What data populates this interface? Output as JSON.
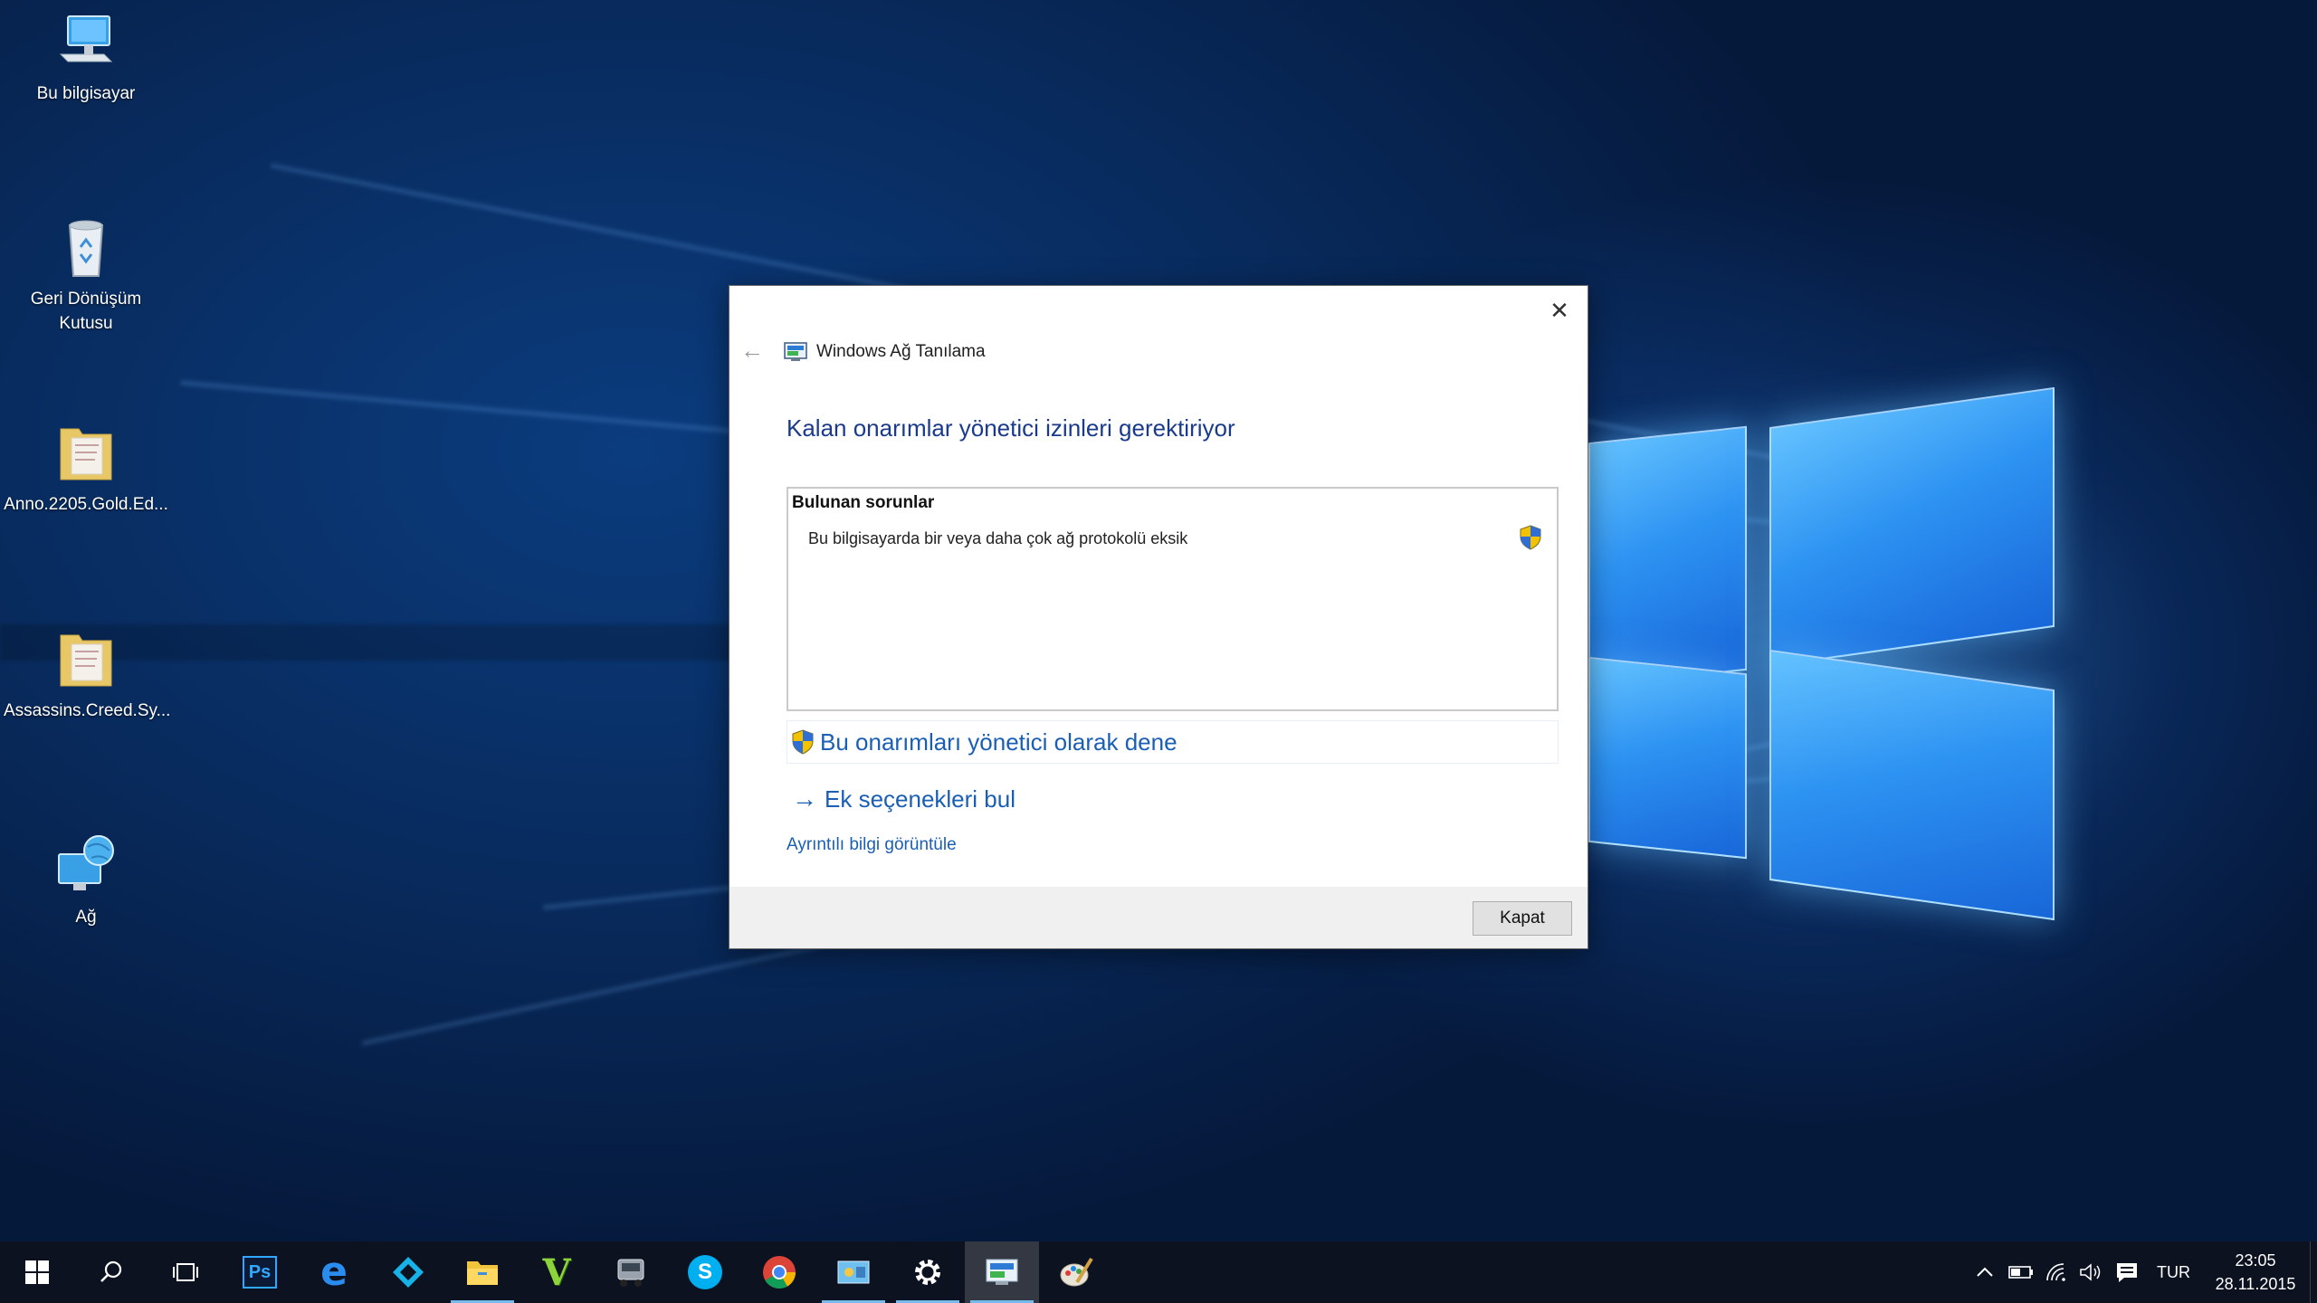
{
  "desktop": {
    "icons": [
      {
        "label": "Bu bilgisayar",
        "icon": "this-pc-icon"
      },
      {
        "label": "Geri Dönüşüm Kutusu",
        "icon": "recycle-bin-icon"
      },
      {
        "label": "Anno.2205.Gold.Ed...",
        "icon": "folder-icon"
      },
      {
        "label": "Assassins.Creed.Sy...",
        "icon": "folder-icon"
      },
      {
        "label": "Ağ",
        "icon": "network-icon"
      }
    ]
  },
  "dialog": {
    "app_title": "Windows Ağ Tanılama",
    "heading": "Kalan onarımlar yönetici izinleri gerektiriyor",
    "problems_title": "Bulunan sorunlar",
    "problems": [
      "Bu bilgisayarda bir veya daha çok ağ protokolü eksik"
    ],
    "action_admin": "Bu onarımları yönetici olarak dene",
    "action_more": "Ek seçenekleri bul",
    "details_link": "Ayrıntılı bilgi görüntüle",
    "close_label": "Kapat",
    "close_glyph": "✕",
    "back_glyph": "←",
    "arrow_glyph": "→"
  },
  "taskbar": {
    "apps": [
      {
        "icon": "photoshop-icon",
        "text": "Ps"
      },
      {
        "icon": "edge-icon",
        "text": "e"
      },
      {
        "icon": "kodi-icon"
      },
      {
        "icon": "file-explorer-icon"
      },
      {
        "icon": "vegas-icon",
        "text": "V"
      },
      {
        "icon": "truck-icon"
      },
      {
        "icon": "skype-icon",
        "text": "S"
      },
      {
        "icon": "chrome-icon"
      },
      {
        "icon": "control-panel-icon"
      },
      {
        "icon": "settings-icon"
      },
      {
        "icon": "network-diagnostics-icon"
      },
      {
        "icon": "paint-icon"
      }
    ],
    "language": "TUR",
    "time": "23:05",
    "date": "28.11.2015"
  },
  "colors": {
    "accent_link": "#1a5fb4",
    "heading": "#1a3a8c",
    "taskbar": "#0c1220"
  }
}
